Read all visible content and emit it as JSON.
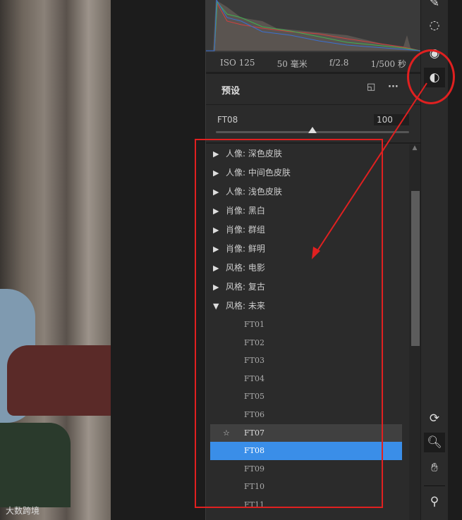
{
  "exif": {
    "iso": "ISO 125",
    "focal": "50 毫米",
    "aperture": "f/2.8",
    "shutter": "1/500 秒"
  },
  "presets": {
    "title": "预设",
    "current_name": "FT08",
    "amount": "100",
    "amount_fraction": 0.5,
    "groups": [
      {
        "label": "人像: 深色皮肤",
        "expanded": false
      },
      {
        "label": "人像: 中间色皮肤",
        "expanded": false
      },
      {
        "label": "人像: 浅色皮肤",
        "expanded": false
      },
      {
        "label": "肖像: 黑白",
        "expanded": false
      },
      {
        "label": "肖像: 群组",
        "expanded": false
      },
      {
        "label": "肖像: 鲜明",
        "expanded": false
      },
      {
        "label": "风格: 电影",
        "expanded": false
      },
      {
        "label": "风格: 复古",
        "expanded": false
      },
      {
        "label": "风格: 未来",
        "expanded": true
      }
    ],
    "items": [
      "FT01",
      "FT02",
      "FT03",
      "FT04",
      "FT05",
      "FT06",
      "FT07",
      "FT08",
      "FT09",
      "FT10",
      "FT11"
    ],
    "hovered": "FT07",
    "selected": "FT08"
  },
  "watermark": "大数跨境",
  "colors": {
    "accent": "#3a8ee8",
    "annotation": "#e02020"
  }
}
